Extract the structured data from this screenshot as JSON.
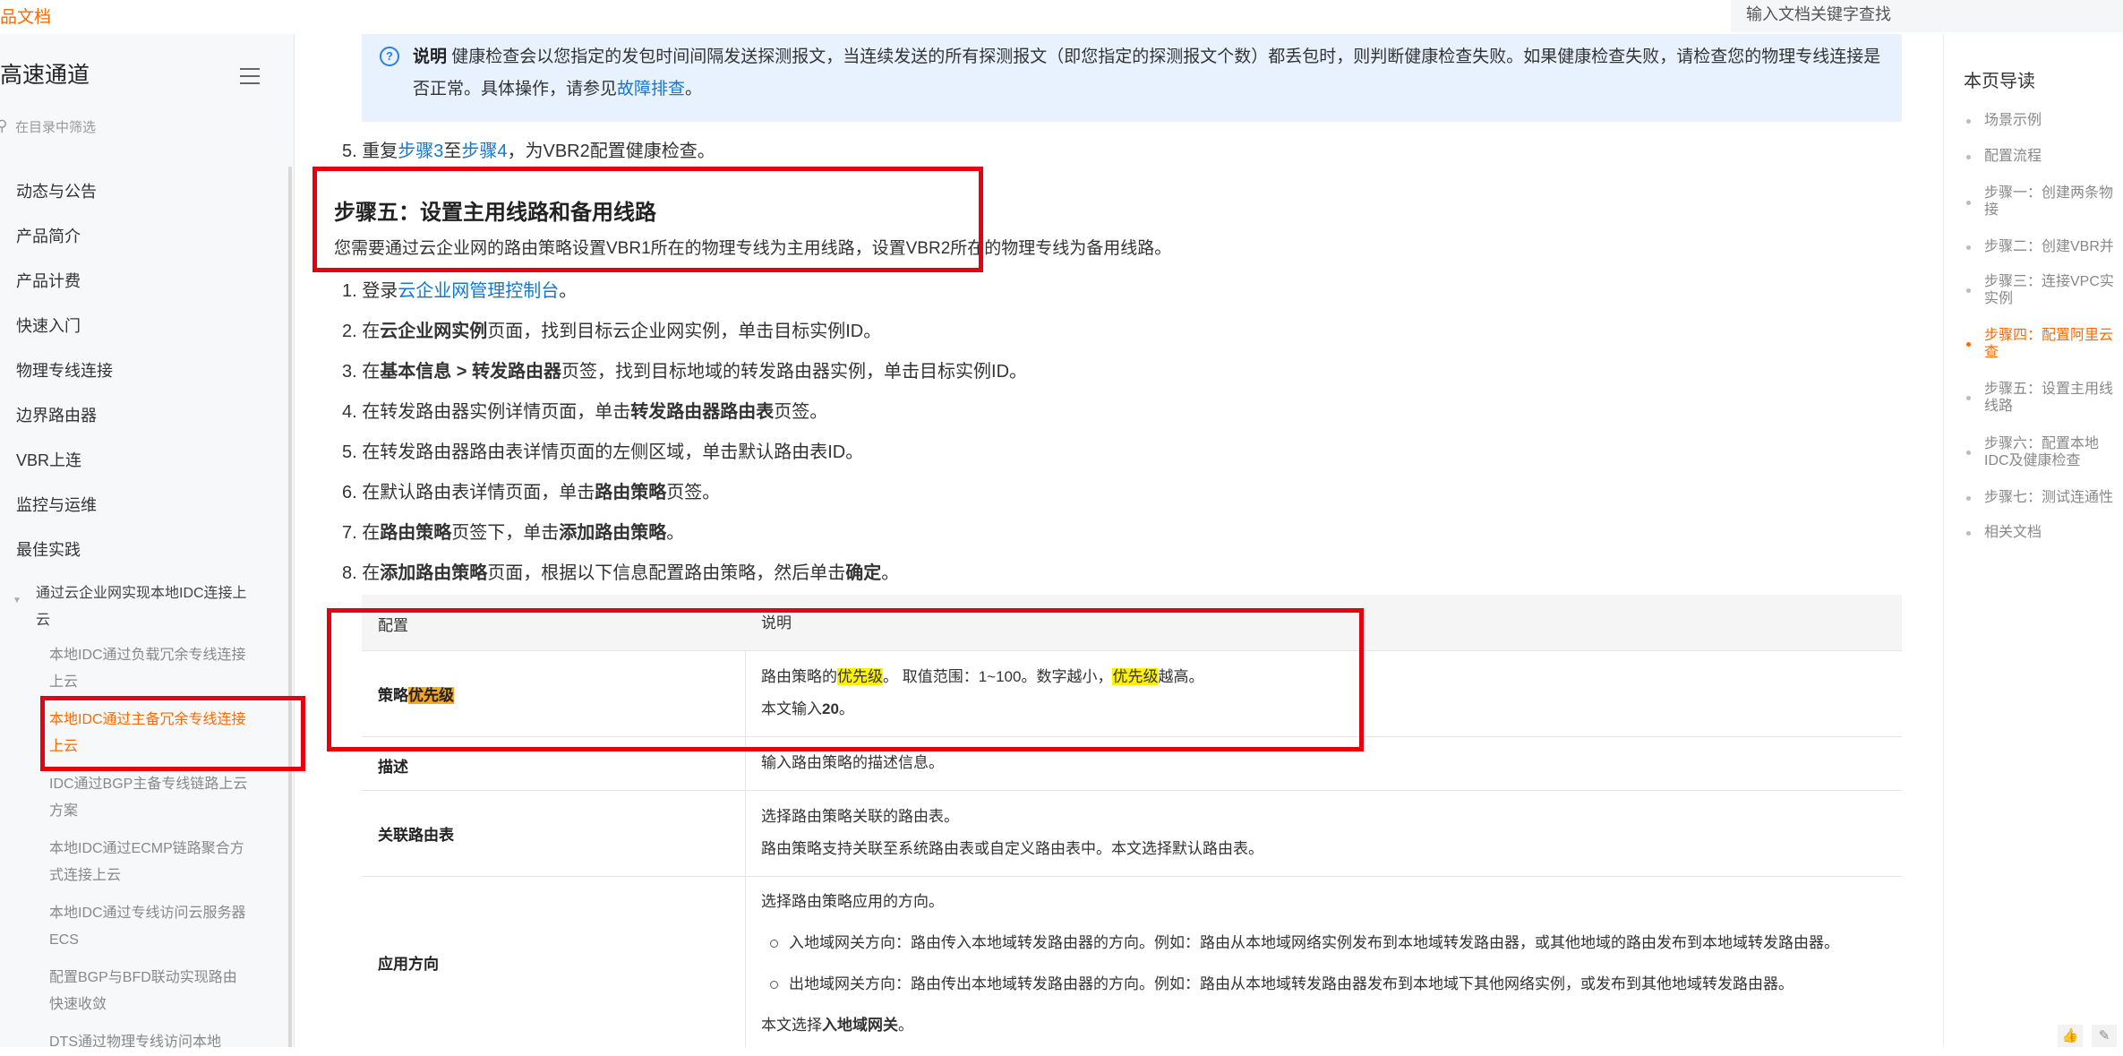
{
  "header": {
    "brand": "品文档",
    "search_placeholder": "输入文档关键字查找"
  },
  "sidebar": {
    "title": "高速通道",
    "filter_placeholder": "在目录中筛选",
    "items": [
      "动态与公告",
      "产品简介",
      "产品计费",
      "快速入门",
      "物理专线连接",
      "边界路由器",
      "VBR上连",
      "监控与运维",
      "最佳实践"
    ],
    "section": "通过云企业网实现本地IDC连接上云",
    "sub_items": [
      "本地IDC通过负载冗余专线连接上云",
      "本地IDC通过主备冗余专线连接上云",
      "IDC通过BGP主备专线链路上云方案",
      "本地IDC通过ECMP链路聚合方式连接上云",
      "本地IDC通过专线访问云服务器ECS",
      "配置BGP与BFD联动实现路由快速收敛",
      "DTS通过物理专线访问本地"
    ]
  },
  "note": {
    "label": "说明",
    "text_before": " 健康检查会以您指定的发包时间间隔发送探测报文，当连续发送的所有探测报文（即您指定的探测报文个数）都丢包时，则判断健康检查失败。如果健康检查失败，请检查您的物理专线连接是否正常。具体操作，请参见",
    "link": "故障排查",
    "text_after": "。"
  },
  "step5_prev": {
    "prefix": "5. 重复",
    "link1": "步骤3",
    "mid": "至",
    "link2": "步骤4",
    "suffix": "，为VBR2配置健康检查。"
  },
  "section": {
    "heading": "步骤五：设置主用线路和备用线路",
    "description": "您需要通过云企业网的路由策略设置VBR1所在的物理专线为主用线路，设置VBR2所在的物理专线为备用线路。"
  },
  "steps": {
    "s1_prefix": "1. 登录",
    "s1_link": "云企业网管理控制台",
    "s1_suffix": "。",
    "s2_a": "2. 在",
    "s2_b": "云企业网实例",
    "s2_c": "页面，找到目标云企业网实例，单击目标实例ID。",
    "s3_a": "3. 在",
    "s3_b": "基本信息 > 转发路由器",
    "s3_c": "页签，找到目标地域的转发路由器实例，单击目标实例ID。",
    "s4_a": "4. 在转发路由器实例详情页面，单击",
    "s4_b": "转发路由器路由表",
    "s4_c": "页签。",
    "s5": "5. 在转发路由器路由表详情页面的左侧区域，单击默认路由表ID。",
    "s6_a": "6. 在默认路由表详情页面，单击",
    "s6_b": "路由策略",
    "s6_c": "页签。",
    "s7_a": "7. 在",
    "s7_b": "路由策略",
    "s7_c": "页签下，单击",
    "s7_d": "添加路由策略",
    "s7_e": "。",
    "s8_a": "8. 在",
    "s8_b": "添加路由策略",
    "s8_c": "页面，根据以下信息配置路由策略，然后单击",
    "s8_d": "确定",
    "s8_e": "。"
  },
  "table": {
    "headers": [
      "配置",
      "说明"
    ],
    "priority": {
      "label_a": "策略",
      "label_b": "优先级",
      "line1_a": "路由策略的",
      "line1_b": "优先级",
      "line1_c": "。 取值范围：1~100。数字越小，",
      "line1_d": "优先级",
      "line1_e": "越高。",
      "line2_a": "本文输入",
      "line2_b": "20",
      "line2_c": "。"
    },
    "description": {
      "label": "描述",
      "text": "输入路由策略的描述信息。"
    },
    "route_table": {
      "label": "关联路由表",
      "line1": "选择路由策略关联的路由表。",
      "line2": "路由策略支持关联至系统路由表或自定义路由表中。本文选择默认路由表。"
    },
    "direction": {
      "label": "应用方向",
      "line1": "选择路由策略应用的方向。",
      "bullet1": "入地域网关方向：路由传入本地域转发路由器的方向。例如：路由从本地域网络实例发布到本地域转发路由器，或其他地域的路由发布到本地域转发路由器。",
      "bullet2": "出地域网关方向：路由传出本地域转发路由器的方向。例如：路由从本地域转发路由器发布到本地域下其他网络实例，或发布到其他地域转发路由器。",
      "line_end_a": "本文选择",
      "line_end_b": "入地域网关",
      "line_end_c": "。"
    }
  },
  "toc": {
    "title": "本页导读",
    "items": [
      "场景示例",
      "配置流程",
      "步骤一：创建两条物接",
      "步骤二：创建VBR并",
      "步骤三：连接VPC实实例",
      "步骤四：配置阿里云查",
      "步骤五：设置主用线线路",
      "步骤六：配置本地IDC及健康检查",
      "步骤七：测试连通性",
      "相关文档"
    ]
  },
  "colors": {
    "accent": "#ff6a00",
    "link": "#1677d2",
    "annotation_red": "#e60012",
    "highlight_yellow": "#fff200",
    "note_bg": "#e8f2ff"
  }
}
